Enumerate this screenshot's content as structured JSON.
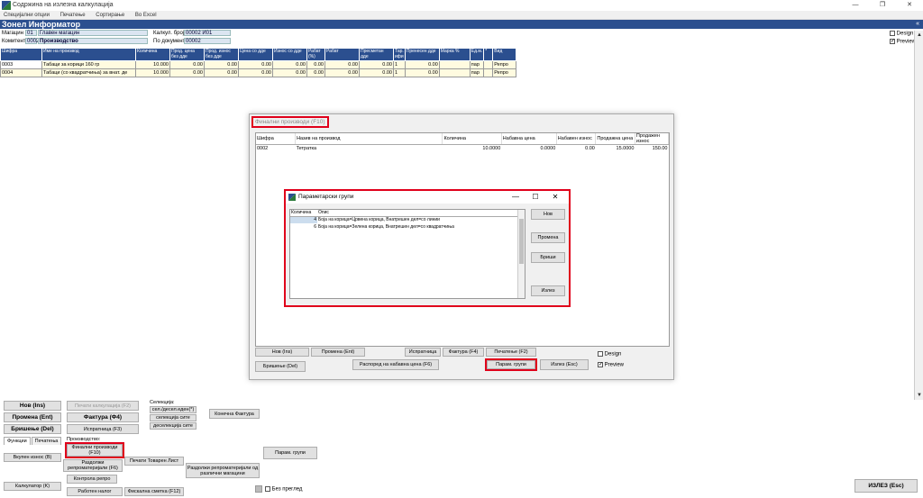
{
  "window": {
    "title": "Содржина на излезна калкулација",
    "minimize": "—",
    "restore": "❐",
    "close": "✕"
  },
  "menu": [
    "Специјални опции",
    "Печатење",
    "Сортирање",
    "Во Excel"
  ],
  "header": {
    "title": "Зонел Информатор",
    "collapse": "«"
  },
  "form": {
    "magacin_label": "Магацин",
    "magacin_code": "01",
    "magacin_name": "Главен магацин",
    "komitent_label": "Комитент",
    "komitent_code": "0002",
    "komitent_name": "Производство",
    "kalk_label": "Калкул. број",
    "kalk_value": "00002 И01",
    "dok_label": "По документ",
    "dok_value": "00002",
    "design_label": "Design",
    "preview_label": "Preview"
  },
  "grid": {
    "headers": [
      "Шифра",
      "Име на производ",
      "Количина",
      "Прод. цена без дде",
      "Прод. износ без дде",
      "Цена со дде",
      "Износ со дде",
      "Рабат (%)",
      "Рабат",
      "Пресметан дде",
      "Тар. ифи",
      "Пренесен дде",
      "Марка %",
      "Ед.м.",
      "*",
      "Вид"
    ],
    "rows": [
      [
        "0003",
        "Табаци за корици 160 гр",
        "10.000",
        "0.00",
        "0.00",
        "0.00",
        "0.00",
        "0.00",
        "0.00",
        "0.00",
        "1",
        "0.00",
        "",
        "пар",
        "",
        "Репро"
      ],
      [
        "0004",
        "Табаци (со квадратчиња) за внат. де",
        "10.000",
        "0.00",
        "0.00",
        "0.00",
        "0.00",
        "0.00",
        "0.00",
        "0.00",
        "1",
        "0.00",
        "",
        "пар",
        "",
        "Репро"
      ]
    ]
  },
  "final_dialog": {
    "title": "Финални производи (F10)",
    "headers": [
      "Шифра",
      "Назив на производ",
      "Количина",
      "Набавна цена",
      "Набавен износ",
      "Продажна цена",
      "Продажен износ"
    ],
    "rows": [
      [
        "0002",
        "Тетратка",
        "10.0000",
        "0.0000",
        "0.00",
        "15.0000",
        "150.00"
      ]
    ],
    "buttons": {
      "nov": "Нов (Ins)",
      "promena": "Промена (Ent)",
      "brishenje": "Бришење (Del)",
      "ispratnica": "Испратница",
      "faktura": "Фактура (F4)",
      "pechatenje": "Печатење (F2)",
      "raspored": "Распоред на набавна цена (F6)",
      "param": "Парам. групи",
      "izlez": "Излез (Esc)"
    },
    "design_label": "Design",
    "preview_label": "Preview"
  },
  "param_dialog": {
    "title": "Параметарски групи",
    "headers": [
      "Количина",
      "Опис"
    ],
    "rows": [
      [
        "4",
        "Боја на корица=Црвена корица, Внатрешен дел=со линии"
      ],
      [
        "6",
        "Боја на корица=Зелена корица, Внатрешен дел=со квадратчиња"
      ]
    ],
    "buttons": {
      "nov": "Нов",
      "promena": "Промена",
      "brishi": "Бриши",
      "izlez": "Излез"
    }
  },
  "bottom": {
    "nov": "Нов (Ins)",
    "promena": "Промена (Ent)",
    "brishenje": "Бришење (Del)",
    "pechati_kalk": "Печати калкулација (F2)",
    "faktura": "Фактура (Ф4)",
    "ispratnica": "Испратница (F3)",
    "selekcija_label": "Селекција:",
    "sel_desel": "сел./десел.еден(*)",
    "selekcija_site": "селекција сите",
    "deselekcija_site": "деселекција сите",
    "konechna_faktura": "Конечна Фактура",
    "tabs": [
      "Функции",
      "Печатења"
    ],
    "vkupen_iznos": "Вкупен износ (B)",
    "kalkulator": "Калкулатор (K)",
    "proizvodstvo_label": "Производство:",
    "finalni": "Финални производи (F10)",
    "razdolzhi_repro": "Раздолжи репроматеријали (F6)",
    "pechati_tovaren": "Печати Товарен Лист",
    "kontrola_repro": "Контрола репро",
    "raboten_nalog": "Работен налог",
    "fiskalna": "Фискална сметка (F12)",
    "razdolzhi_razlichni": "Раздолжи репроматеријали од различни магацини",
    "param_grupi": "Парам. групи",
    "bez_pregled": "Без преглед",
    "izlez": "ИЗЛЕЗ (Esc)"
  }
}
